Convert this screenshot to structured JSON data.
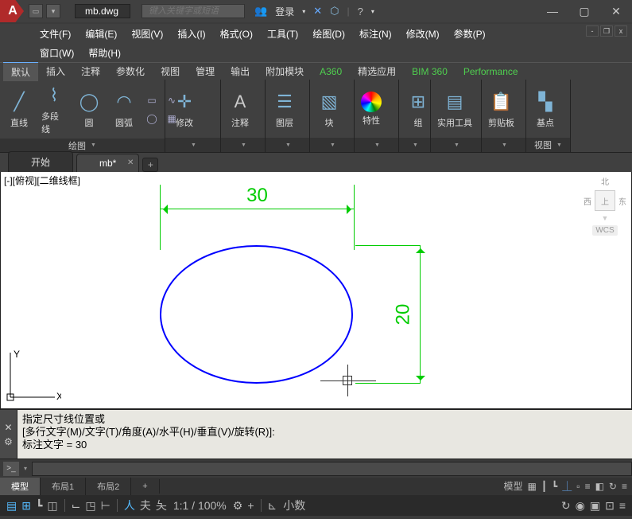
{
  "title": {
    "filename": "mb.dwg",
    "search_placeholder": "键入关键字或短语",
    "login": "登录"
  },
  "menu": {
    "file": "文件(F)",
    "edit": "编辑(E)",
    "view": "视图(V)",
    "insert": "插入(I)",
    "format": "格式(O)",
    "tools": "工具(T)",
    "draw": "绘图(D)",
    "dim": "标注(N)",
    "modify": "修改(M)",
    "param": "参数(P)",
    "window": "窗口(W)",
    "help": "帮助(H)"
  },
  "ribbon_tabs": {
    "default": "默认",
    "insert": "插入",
    "annotate": "注释",
    "parametric": "参数化",
    "view": "视图",
    "manage": "管理",
    "output": "输出",
    "addons": "附加模块",
    "a360": "A360",
    "featured": "精选应用",
    "bim": "BIM 360",
    "perf": "Performance"
  },
  "panels": {
    "draw": {
      "label": "绘图",
      "line": "直线",
      "pline": "多段线",
      "circle": "圆",
      "arc": "圆弧"
    },
    "modify": {
      "label": "修改"
    },
    "annotate": {
      "label": "注释"
    },
    "layers": {
      "label": "图层"
    },
    "block": {
      "label": "块"
    },
    "properties": {
      "label": "特性"
    },
    "groups": {
      "label": "组"
    },
    "utilities": {
      "label": "实用工具"
    },
    "clipboard": {
      "label": "剪贴板"
    },
    "base": {
      "label": "基点"
    },
    "view": {
      "label": "视图"
    }
  },
  "tabs": {
    "start": "开始",
    "doc": "mb*"
  },
  "canvas": {
    "viewlabel": "[-][俯视][二维线框]",
    "dim_h": "30",
    "dim_v": "20",
    "wcs": "WCS",
    "nav_n": "北",
    "nav_w": "西",
    "nav_top": "上",
    "nav_e": "东"
  },
  "cmd": {
    "line1": "指定尺寸线位置或",
    "line2": "[多行文字(M)/文字(T)/角度(A)/水平(H)/垂直(V)/旋转(R)]:",
    "line3": "标注文字 = 30"
  },
  "layout": {
    "model": "模型",
    "l1": "布局1",
    "l2": "布局2"
  },
  "status": {
    "model": "模型",
    "scale": "1:1 / 100%",
    "coords": "小数"
  }
}
